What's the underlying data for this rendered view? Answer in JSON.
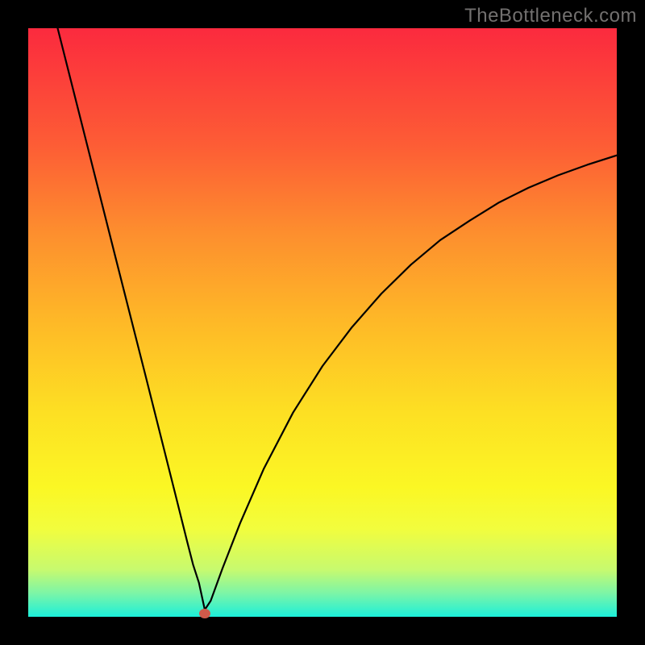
{
  "watermark": "TheBottleneck.com",
  "chart_data": {
    "type": "line",
    "title": "",
    "xlabel": "",
    "ylabel": "",
    "xlim": [
      0,
      100
    ],
    "ylim": [
      0,
      100
    ],
    "background_gradient": {
      "top": "#fb2a3e",
      "bottom": "#1cefda"
    },
    "marker": {
      "x": 30,
      "y": 0.5
    },
    "series": [
      {
        "name": "curve",
        "x": [
          5,
          10,
          15,
          20,
          25,
          27,
          28,
          29,
          30,
          31,
          33,
          36,
          40,
          45,
          50,
          55,
          60,
          65,
          70,
          75,
          80,
          85,
          90,
          95,
          100
        ],
        "y": [
          100,
          80.2,
          60.4,
          40.7,
          20.8,
          12.8,
          8.9,
          5.8,
          1.2,
          2.7,
          8.2,
          15.9,
          25.1,
          34.7,
          42.6,
          49.2,
          54.9,
          59.8,
          64.0,
          67.3,
          70.4,
          72.9,
          75.0,
          76.8,
          78.4
        ]
      }
    ]
  }
}
